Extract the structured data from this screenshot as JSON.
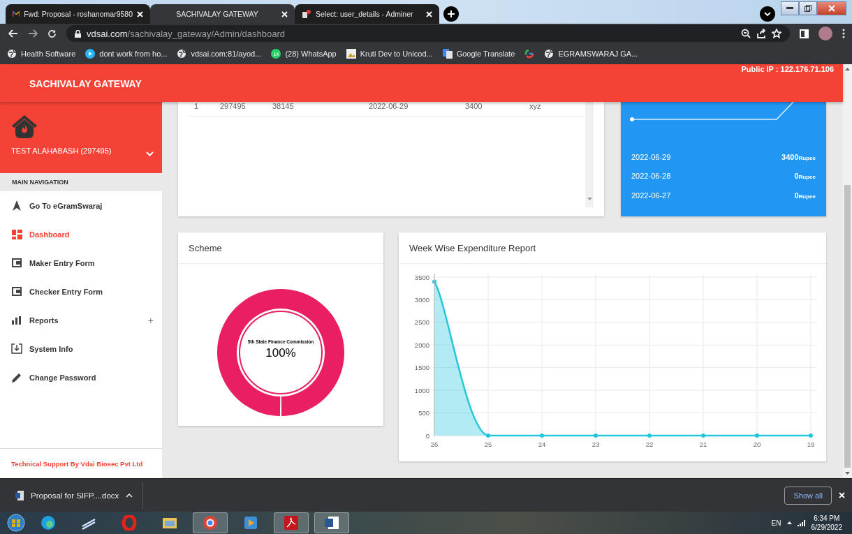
{
  "browser": {
    "tabs": [
      {
        "title": "Fwd: Proposal - roshanomar9580",
        "selected": false
      },
      {
        "title": "SACHIVALAY GATEWAY",
        "selected": true
      },
      {
        "title": "Select: user_details - Adminer",
        "selected": false
      }
    ],
    "url_host": "vdsai.com",
    "url_path": "/sachivalay_gateway/Admin/dashboard",
    "bookmarks": [
      {
        "label": "Health Software"
      },
      {
        "label": "dont work from ho..."
      },
      {
        "label": "vdsai.com:81/ayod..."
      },
      {
        "label": "(28) WhatsApp",
        "badge": "14"
      },
      {
        "label": "Kruti Dev to Unicod..."
      },
      {
        "label": "Google Translate"
      },
      {
        "label": "EGRAMSWARAJ GA..."
      }
    ]
  },
  "header": {
    "title": "SACHIVALAY GATEWAY",
    "public_ip": "Public IP : 122.176.71.106"
  },
  "sidebar": {
    "user": "TEST ALAHABASH (297495)",
    "heading": "MAIN NAVIGATION",
    "items": [
      {
        "label": "Go To eGramSwaraj",
        "selected": false
      },
      {
        "label": "Dashboard",
        "selected": true
      },
      {
        "label": "Maker Entry Form",
        "selected": false
      },
      {
        "label": "Checker Entry Form",
        "selected": false
      },
      {
        "label": "Reports",
        "selected": false,
        "expander": "+"
      },
      {
        "label": "System Info",
        "selected": false
      },
      {
        "label": "Change Password",
        "selected": false
      }
    ],
    "footer": "Technical Support By Vdai Biosec Pvt Ltd"
  },
  "table": {
    "rows": [
      [
        "1",
        "297495",
        "38145",
        "2022-06-29",
        "3400",
        "xyz"
      ]
    ]
  },
  "daily_summary": {
    "rows": [
      {
        "date": "2022-06-29",
        "amount": "3400",
        "unit": "Rupee"
      },
      {
        "date": "2022-06-28",
        "amount": "0",
        "unit": "Rupee"
      },
      {
        "date": "2022-06-27",
        "amount": "0",
        "unit": "Rupee"
      }
    ]
  },
  "scheme": {
    "title": "Scheme",
    "slice_label": "5th State Finance Commission",
    "center_value": "100%"
  },
  "expenditure": {
    "chart_data": {
      "type": "area",
      "title": "Week Wise Expenditure Report",
      "x": [
        "26",
        "25",
        "24",
        "23",
        "22",
        "21",
        "20",
        "19"
      ],
      "series": [
        {
          "color": "#26c6da",
          "values": [
            3400,
            0,
            0,
            0,
            0,
            0,
            0,
            0
          ]
        }
      ],
      "grid": true,
      "ylim": [
        0,
        3500
      ],
      "yticks": [
        0,
        500,
        1000,
        1500,
        2000,
        2500,
        3000,
        3500
      ]
    }
  },
  "downloads": {
    "file": "Proposal for SIFP....docx",
    "show_all": "Show all"
  },
  "taskbar": {
    "language": "EN",
    "time": "6:34 PM",
    "date": "6/29/2022"
  }
}
